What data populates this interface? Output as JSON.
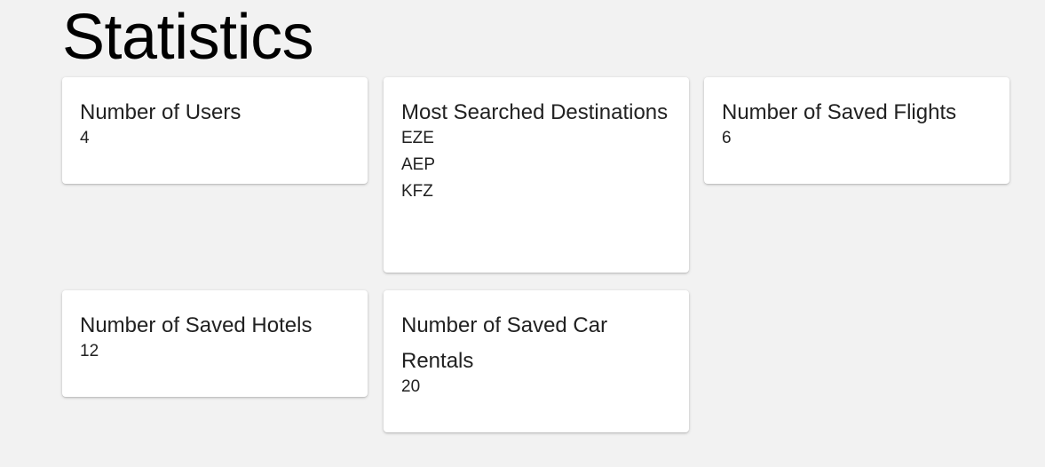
{
  "page": {
    "title": "Statistics"
  },
  "cards": {
    "users": {
      "title": "Number of Users",
      "value": "4"
    },
    "destinations": {
      "title": "Most Searched Destinations",
      "items": [
        "EZE",
        "AEP",
        "KFZ"
      ]
    },
    "flights": {
      "title": "Number of Saved Flights",
      "value": "6"
    },
    "hotels": {
      "title": "Number of Saved Hotels",
      "value": "12"
    },
    "cars": {
      "title": "Number of Saved Car Rentals",
      "value": "20"
    }
  },
  "colors": {
    "background": "#f2f2f2",
    "card": "#ffffff",
    "text": "#212121"
  }
}
